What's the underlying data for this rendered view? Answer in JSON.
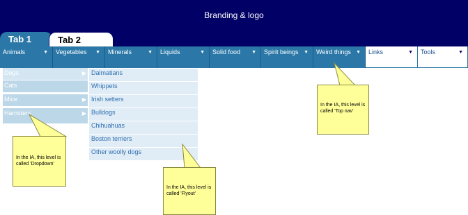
{
  "header": {
    "title": "Branding & logo"
  },
  "tabs": [
    {
      "label": "Tab 1"
    },
    {
      "label": "Tab 2"
    }
  ],
  "top_nav": [
    {
      "label": "Animals"
    },
    {
      "label": "Vegetables"
    },
    {
      "label": "Minerals"
    },
    {
      "label": "Liquids"
    },
    {
      "label": "Solid food"
    },
    {
      "label": "Spirit beings"
    },
    {
      "label": "Weird things"
    },
    {
      "label": "Links"
    },
    {
      "label": "Tools"
    }
  ],
  "dropdown": [
    {
      "label": "Dogs"
    },
    {
      "label": "Cats"
    },
    {
      "label": "Mice"
    },
    {
      "label": "Hamsters"
    }
  ],
  "flyout": [
    {
      "label": "Dalmatians"
    },
    {
      "label": "Whippets"
    },
    {
      "label": "Irish setters"
    },
    {
      "label": "Bulldogs"
    },
    {
      "label": "Chihuahuas"
    },
    {
      "label": "Boston terriers"
    },
    {
      "label": "Other woolly dogs"
    }
  ],
  "callouts": {
    "top_nav": "In the IA, this level is called 'Top nav'",
    "dropdown": "In the IA, this level is called 'Dropdown'",
    "flyout": "In the IA, this level is called 'Flyout'"
  },
  "colors": {
    "header_bg": "#000066",
    "nav_bg": "#2b78a8",
    "dropdown_bg": "#bcd7e8",
    "flyout_bg": "#e0ecf6",
    "callout_bg": "#ffff99",
    "link_text": "#3070b0"
  }
}
